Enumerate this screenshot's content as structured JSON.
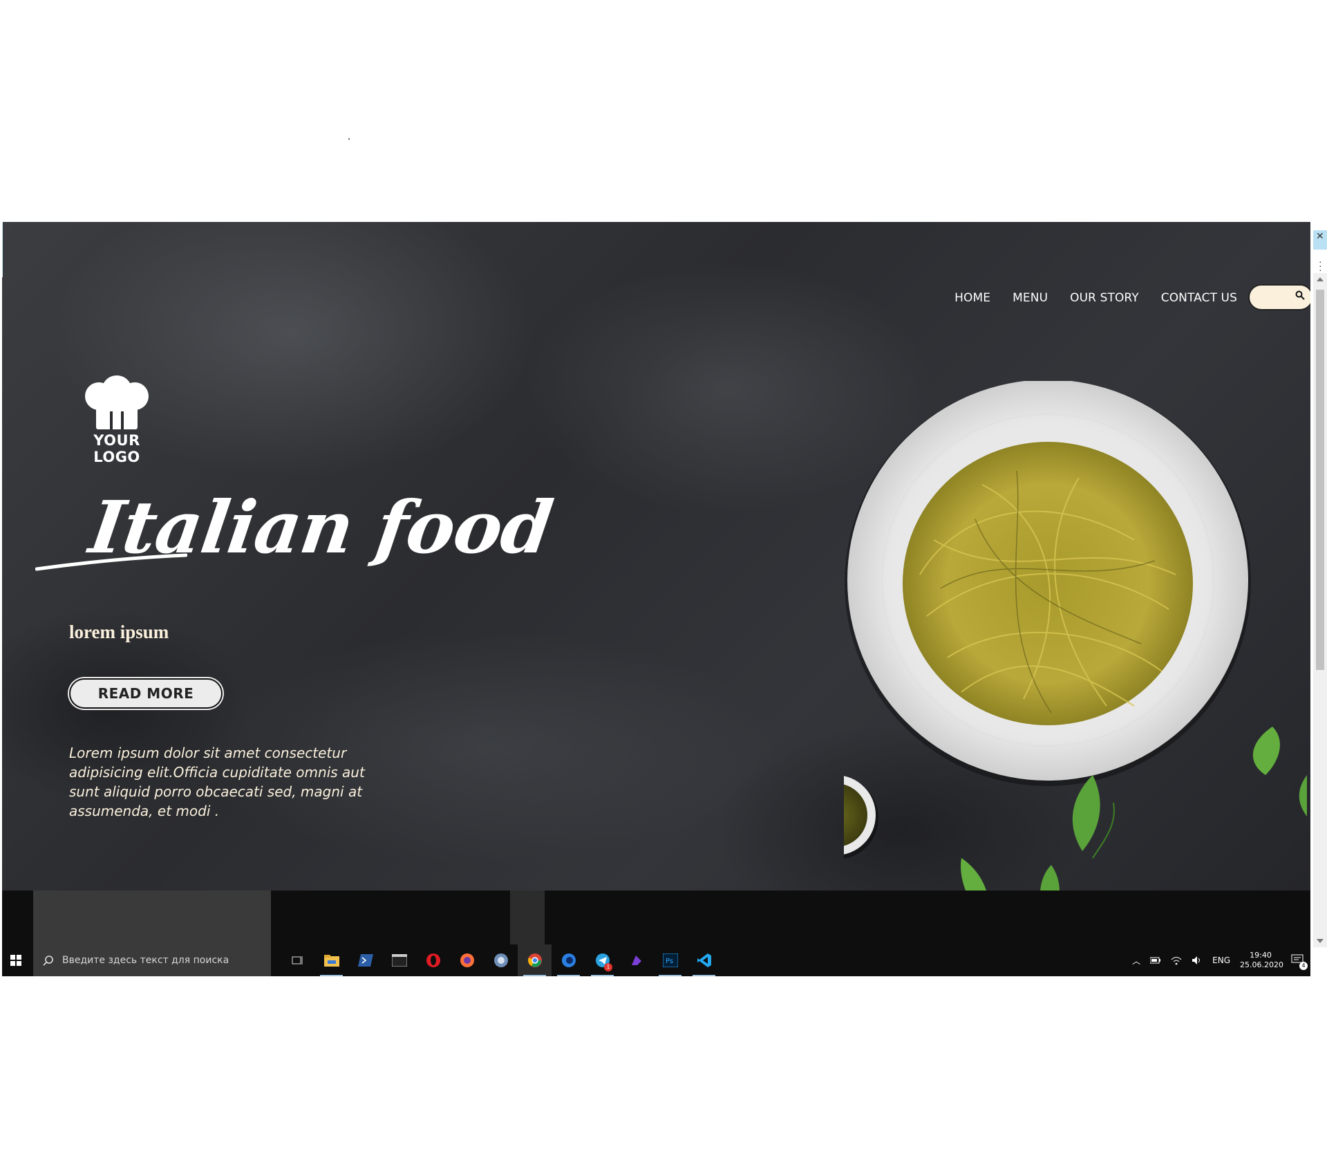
{
  "nav": {
    "items": [
      "HOME",
      "MENU",
      "OUR STORY",
      "CONTACT US"
    ]
  },
  "search": {
    "icon": "search-icon",
    "placeholder": ""
  },
  "logo": {
    "text": "YOUR LOGO",
    "icon": "chef-hat-icon"
  },
  "hero": {
    "title": "Italian food",
    "subtitle": "lorem ipsum",
    "button_label": "READ MORE",
    "description": "Lorem ipsum dolor sit amet consectetur adipisicing elit.Officia cupiditate omnis aut sunt aliquid porro obcaecati sed, magni at assumenda, et modi ."
  },
  "taskbar": {
    "search_placeholder": "Введите здесь текст для поиска",
    "apps": [
      "task-view-icon",
      "file-explorer-icon",
      "powershell-icon",
      "terminal-icon",
      "opera-icon",
      "firefox-icon",
      "network-icon",
      "chrome-icon",
      "firefox-dev-icon",
      "telegram-icon",
      "app-icon",
      "photoshop-icon",
      "vscode-icon"
    ],
    "telegram_badge": "1",
    "language": "ENG",
    "time": "19:40",
    "date": "25.06.2020",
    "notifications": "4"
  },
  "colors": {
    "accent_cream": "#faf0dc",
    "background_dark": "#2b2c30",
    "taskbar": "#0e0e0e"
  }
}
